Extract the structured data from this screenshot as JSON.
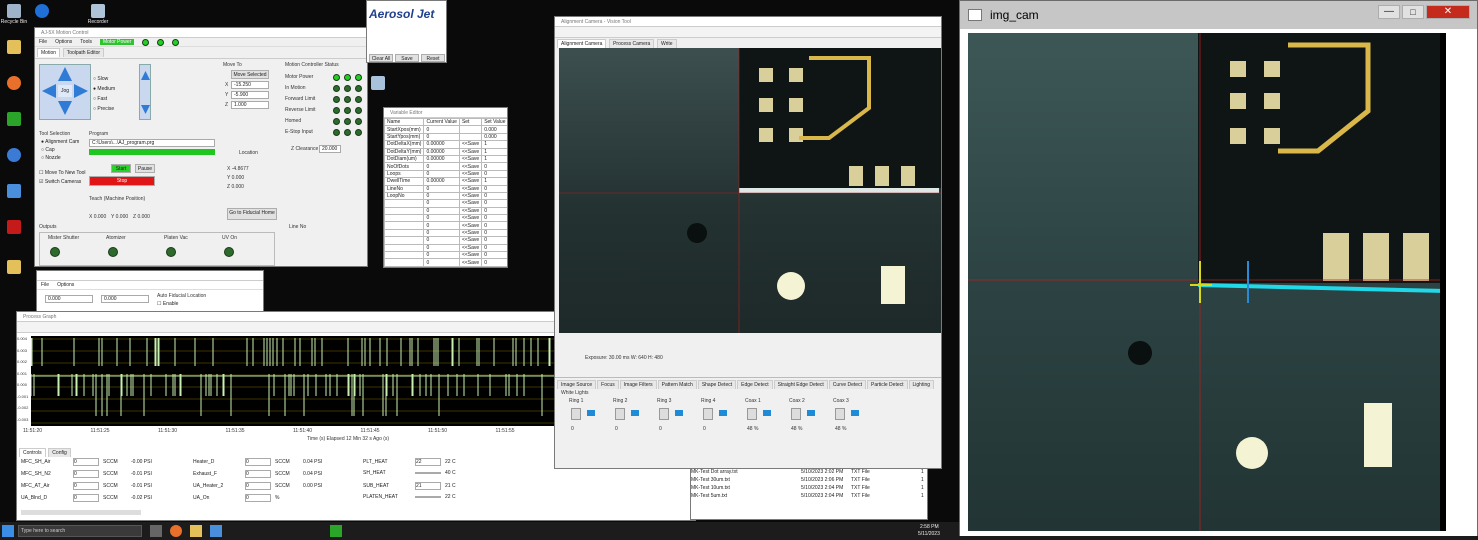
{
  "desktop": {
    "icons": [
      "Recycle Bin",
      "",
      "Recorder",
      "",
      "",
      "",
      "",
      "",
      "",
      "",
      "",
      "",
      ""
    ],
    "taskbar_search": "Type here to search",
    "clock": {
      "time": "2:58 PM",
      "date": "5/11/2023"
    }
  },
  "motion_window": {
    "title": "AJ-5X Motion Control",
    "menu": [
      "File",
      "Options",
      "Tools"
    ],
    "motor_power_label": "Motor Power",
    "tabs": [
      "Motion",
      "Toolpath Editor"
    ],
    "move_to_label": "Move To",
    "move_selected": "Move Selected",
    "jog_label": "Jog",
    "axis_rows": [
      {
        "axis": "X",
        "value": "-15.250"
      },
      {
        "axis": "Y",
        "value": "-5.900"
      },
      {
        "axis": "Z",
        "value": "1.000"
      }
    ],
    "speed_options": [
      "Slow",
      "Medium",
      "Fast",
      "Precise"
    ],
    "tool_select_label": "Tool Selection",
    "tool_options": [
      "Alignment Cam",
      "Cap",
      "Nozzle"
    ],
    "move_to_new_tool": "Move To New Tool",
    "switch_cameras": "Switch Cameras",
    "program_label": "Program",
    "program_file": "C:\\Users\\...\\AJ_program.prg",
    "start_label": "Start",
    "stop_label": "Stop",
    "pause_label": "Pause",
    "location_label": "Location",
    "location_values": [
      {
        "axis": "X",
        "value": "-4.8677"
      },
      {
        "axis": "Y",
        "value": "0.000"
      },
      {
        "axis": "Z",
        "value": "0.000"
      }
    ],
    "teach_label": "Teach (Machine Position)",
    "teach_values": [
      "X 0.000",
      "Y 0.000",
      "Z 0.000"
    ],
    "go_home_label": "Go to Fiducial Home",
    "status_label": "Motion Controller Status",
    "status_items": [
      "Motor Power",
      "In Motion",
      "Forward Limit",
      "Reverse Limit",
      "Homed",
      "E-Stop Input"
    ],
    "z_clearance_label": "Z Clearance",
    "z_clearance_value": "20.000",
    "outputs_label": "Outputs",
    "output_groups": [
      "Mister Shutter",
      "Atomizer",
      "Platen Vac",
      "UV On"
    ],
    "atomizer_label": "Atomizer",
    "line_no_label": "Line No"
  },
  "aerosol_panel": {
    "logo": "Aerosol Jet",
    "buttons": [
      "Clear All",
      "Save",
      "Reset"
    ]
  },
  "variable_window": {
    "title": "Variable Editor",
    "headers": [
      "Name",
      "Current Value",
      "Set",
      "Set Value"
    ],
    "rows": [
      {
        "name": "StartXpos(mm)",
        "val": "0",
        "set": "",
        "sv": "0.000"
      },
      {
        "name": "StartYpos(mm)",
        "val": "0",
        "set": "",
        "sv": "0.000"
      },
      {
        "name": "DotDeltaX(mm)",
        "val": "0.00000",
        "set": "<<Save",
        "sv": "1"
      },
      {
        "name": "DotDeltaY(mm)",
        "val": "0.00000",
        "set": "<<Save",
        "sv": "1"
      },
      {
        "name": "DotDiam(um)",
        "val": "0.00000",
        "set": "<<Save",
        "sv": "1"
      },
      {
        "name": "NoOfDots",
        "val": "0",
        "set": "<<Save",
        "sv": "0"
      },
      {
        "name": "Loops",
        "val": "0",
        "set": "<<Save",
        "sv": "0"
      },
      {
        "name": "DwellTime",
        "val": "0.00000",
        "set": "<<Save",
        "sv": "1"
      },
      {
        "name": "LineNo",
        "val": "0",
        "set": "<<Save",
        "sv": "0"
      },
      {
        "name": "LoopNo",
        "val": "0",
        "set": "<<Save",
        "sv": "0"
      },
      {
        "name": "",
        "val": "0",
        "set": "<<Save",
        "sv": "0"
      },
      {
        "name": "",
        "val": "0",
        "set": "<<Save",
        "sv": "0"
      },
      {
        "name": "",
        "val": "0",
        "set": "<<Save",
        "sv": "0"
      },
      {
        "name": "",
        "val": "0",
        "set": "<<Save",
        "sv": "0"
      },
      {
        "name": "",
        "val": "0",
        "set": "<<Save",
        "sv": "0"
      },
      {
        "name": "",
        "val": "0",
        "set": "<<Save",
        "sv": "0"
      },
      {
        "name": "",
        "val": "0",
        "set": "<<Save",
        "sv": "0"
      },
      {
        "name": "",
        "val": "0",
        "set": "<<Save",
        "sv": "0"
      },
      {
        "name": "",
        "val": "0",
        "set": "<<Save",
        "sv": "0"
      },
      {
        "name": "",
        "val": "0",
        "set": "<<Save",
        "sv": "0"
      }
    ]
  },
  "camera_window": {
    "title": "Alignment Camera - Vision Tool",
    "tabs": [
      "Alignment Camera",
      "Process Camera",
      "Write"
    ],
    "status_bar": "Exposure: 30.00 ms   W: 640  H: 480",
    "bottom_tabs": [
      "Image Source",
      "Focus",
      "Image Filters",
      "Pattern Match",
      "Shape Detect",
      "Edge Detect",
      "Straight Edge Detect",
      "Curve Detect",
      "Particle Detect",
      "Lighting"
    ],
    "lighting_label": "White Lights",
    "light_labels": [
      "Ring 1",
      "Ring 2",
      "Ring 3",
      "Ring 4",
      "Coax 1",
      "Coax 2",
      "Coax 3"
    ],
    "light_values": [
      "0",
      "0",
      "0",
      "0",
      "48 %",
      "48 %",
      "48 %"
    ]
  },
  "img_cam": {
    "title": "img_cam"
  },
  "small_window": {
    "menu": [
      "File",
      "Options"
    ],
    "auto_fiducial_label": "Auto Fiducial Location",
    "enable_label": "Enable",
    "fields": [
      "0.000",
      "0.000"
    ]
  },
  "graph_window": {
    "title": "Process Graph",
    "y_ticks": [
      "-0.003",
      "-0.002",
      "-0.001",
      "0.000",
      "0.001",
      "0.002",
      "0.003",
      "0.004"
    ],
    "x_ticks": [
      "11:51:20",
      "11:51:25",
      "11:51:30",
      "11:51:35",
      "11:51:40",
      "11:51:45",
      "11:51:50",
      "11:51:55",
      "11:52:00"
    ],
    "x_label": "Time (s) Elapsed 12 Min 32 s Ago (s)",
    "tabs": [
      "Controls",
      "Config"
    ],
    "controls": [
      {
        "name": "MFC_SH_Air",
        "value": "0",
        "unit": "SCCM",
        "extra": "-0.00 PSI"
      },
      {
        "name": "MFC_SH_N2",
        "value": "0",
        "unit": "SCCM",
        "extra": "-0.01 PSI"
      },
      {
        "name": "MFC_AT_Air",
        "value": "0",
        "unit": "SCCM",
        "extra": "-0.01 PSI"
      },
      {
        "name": "UA_Blnd_D",
        "value": "0",
        "unit": "SCCM",
        "extra": "-0.02 PSI"
      }
    ],
    "controls2": [
      {
        "name": "Heater_D",
        "value": "0",
        "unit": "SCCM",
        "extra": "0.04 PSI"
      },
      {
        "name": "Exhaust_F",
        "value": "0",
        "unit": "SCCM",
        "extra": "0.04 PSI"
      },
      {
        "name": "UA_Heater_2",
        "value": "0",
        "unit": "SCCM",
        "extra": "0.00 PSI"
      },
      {
        "name": "UA_On",
        "value": "0",
        "unit": "%",
        "extra": ""
      }
    ],
    "controls3": [
      {
        "name": "PLT_HEAT",
        "value": "22",
        "unit": "22 C"
      },
      {
        "name": "SH_HEAT",
        "value": "",
        "unit": "40 C"
      },
      {
        "name": "SUB_HEAT",
        "value": "21",
        "unit": "21 C"
      },
      {
        "name": "PLATEN_HEAT",
        "value": "",
        "unit": "22 C"
      }
    ]
  },
  "file_list": {
    "rows": [
      {
        "name": "MK-Test Dot array.txt",
        "date": "5/10/2023 2:02 PM",
        "type": "TXT File",
        "size": "1"
      },
      {
        "name": "MK-Test 30um.txt",
        "date": "5/10/2023 2:06 PM",
        "type": "TXT File",
        "size": "1"
      },
      {
        "name": "MK-Test 10um.txt",
        "date": "5/10/2023 2:04 PM",
        "type": "TXT File",
        "size": "1"
      },
      {
        "name": "MK-Test 5um.txt",
        "date": "5/10/2023 2:04 PM",
        "type": "TXT File",
        "size": "1"
      }
    ]
  }
}
